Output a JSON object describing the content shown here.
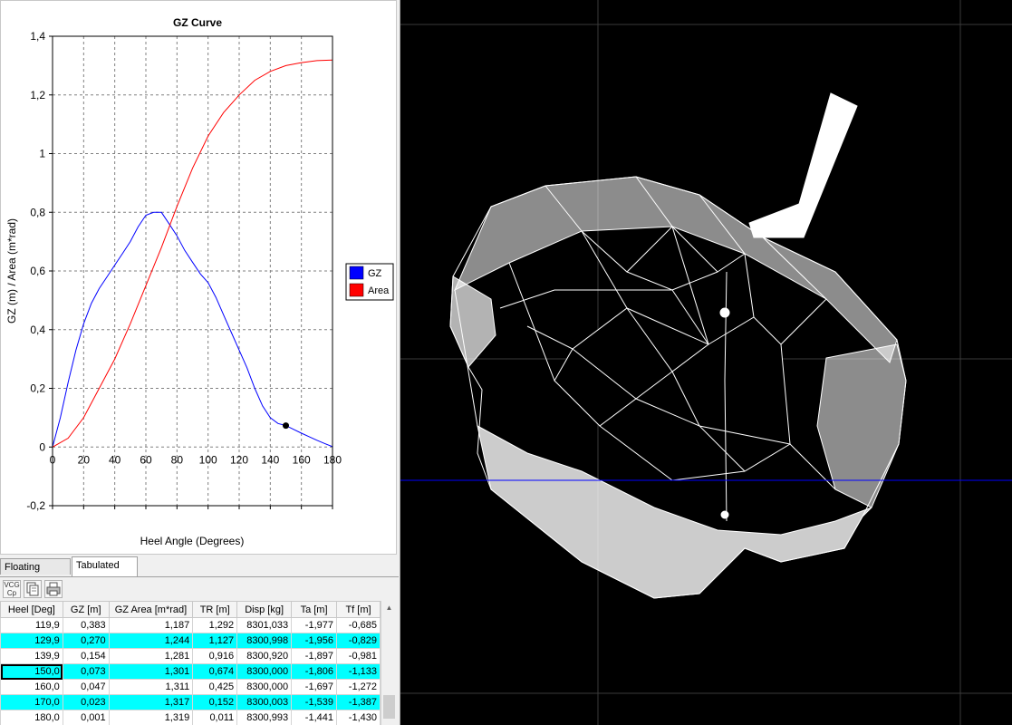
{
  "chart_data": {
    "type": "line",
    "title": "GZ Curve",
    "xlabel": "Heel Angle (Degrees)",
    "ylabel": "GZ (m) / Area (m*rad)",
    "xlim": [
      0,
      180
    ],
    "ylim": [
      -0.2,
      1.4
    ],
    "x_ticks": [
      "0",
      "20",
      "40",
      "60",
      "80",
      "100",
      "120",
      "140",
      "160",
      "180"
    ],
    "y_ticks": [
      "-0,2",
      "0",
      "0,2",
      "0,4",
      "0,6",
      "0,8",
      "1",
      "1,2",
      "1,4"
    ],
    "grid": true,
    "legend_position": "right",
    "series": [
      {
        "name": "GZ",
        "color": "#0000ff",
        "x": [
          0,
          5,
          10,
          15,
          20,
          25,
          30,
          35,
          40,
          45,
          50,
          55,
          60,
          65,
          70,
          75,
          80,
          85,
          90,
          95,
          100,
          105,
          110,
          115,
          120,
          125,
          130,
          135,
          140,
          145,
          150,
          155,
          160,
          165,
          170,
          175,
          180
        ],
        "values": [
          0,
          0.1,
          0.22,
          0.33,
          0.42,
          0.49,
          0.54,
          0.58,
          0.62,
          0.66,
          0.7,
          0.75,
          0.79,
          0.8,
          0.8,
          0.76,
          0.72,
          0.67,
          0.63,
          0.59,
          0.56,
          0.51,
          0.45,
          0.39,
          0.33,
          0.27,
          0.2,
          0.14,
          0.1,
          0.08,
          0.073,
          0.06,
          0.047,
          0.035,
          0.023,
          0.012,
          0.001
        ]
      },
      {
        "name": "Area",
        "color": "#ff0000",
        "x": [
          0,
          10,
          20,
          30,
          40,
          50,
          60,
          70,
          80,
          90,
          100,
          110,
          120,
          130,
          140,
          150,
          160,
          170,
          180
        ],
        "values": [
          0,
          0.03,
          0.1,
          0.2,
          0.3,
          0.42,
          0.55,
          0.68,
          0.82,
          0.95,
          1.06,
          1.14,
          1.2,
          1.25,
          1.28,
          1.3,
          1.31,
          1.317,
          1.319
        ]
      }
    ],
    "marker": {
      "x": 150,
      "y": 0.073
    }
  },
  "tabs": [
    {
      "label": "Floating Position",
      "active": false
    },
    {
      "label": "Tabulated GZ",
      "active": true
    }
  ],
  "toolbar": {
    "vcg_label": "VCG Cp"
  },
  "table": {
    "columns": [
      "Heel [Deg]",
      "GZ [m]",
      "GZ Area [m*rad]",
      "TR [m]",
      "Disp [kg]",
      "Ta [m]",
      "Tf [m]"
    ],
    "rows": [
      {
        "cells": [
          "119,9",
          "0,383",
          "1,187",
          "1,292",
          "8301,033",
          "-1,977",
          "-0,685"
        ],
        "highlight": false
      },
      {
        "cells": [
          "129,9",
          "0,270",
          "1,244",
          "1,127",
          "8300,998",
          "-1,956",
          "-0,829"
        ],
        "highlight": true
      },
      {
        "cells": [
          "139,9",
          "0,154",
          "1,281",
          "0,916",
          "8300,920",
          "-1,897",
          "-0,981"
        ],
        "highlight": false
      },
      {
        "cells": [
          "150,0",
          "0,073",
          "1,301",
          "0,674",
          "8300,000",
          "-1,806",
          "-1,133"
        ],
        "highlight": true
      },
      {
        "cells": [
          "160,0",
          "0,047",
          "1,311",
          "0,425",
          "8300,000",
          "-1,697",
          "-1,272"
        ],
        "highlight": false
      },
      {
        "cells": [
          "170,0",
          "0,023",
          "1,317",
          "0,152",
          "8300,003",
          "-1,539",
          "-1,387"
        ],
        "highlight": true
      },
      {
        "cells": [
          "180,0",
          "0,001",
          "1,319",
          "0,011",
          "8300,993",
          "-1,441",
          "-1,430"
        ],
        "highlight": false
      }
    ]
  },
  "colors": {
    "highlight_row": "#00ffff",
    "viewport_bg": "#000000",
    "waterline": "#0000ff",
    "wireframe": "#ffffff"
  }
}
